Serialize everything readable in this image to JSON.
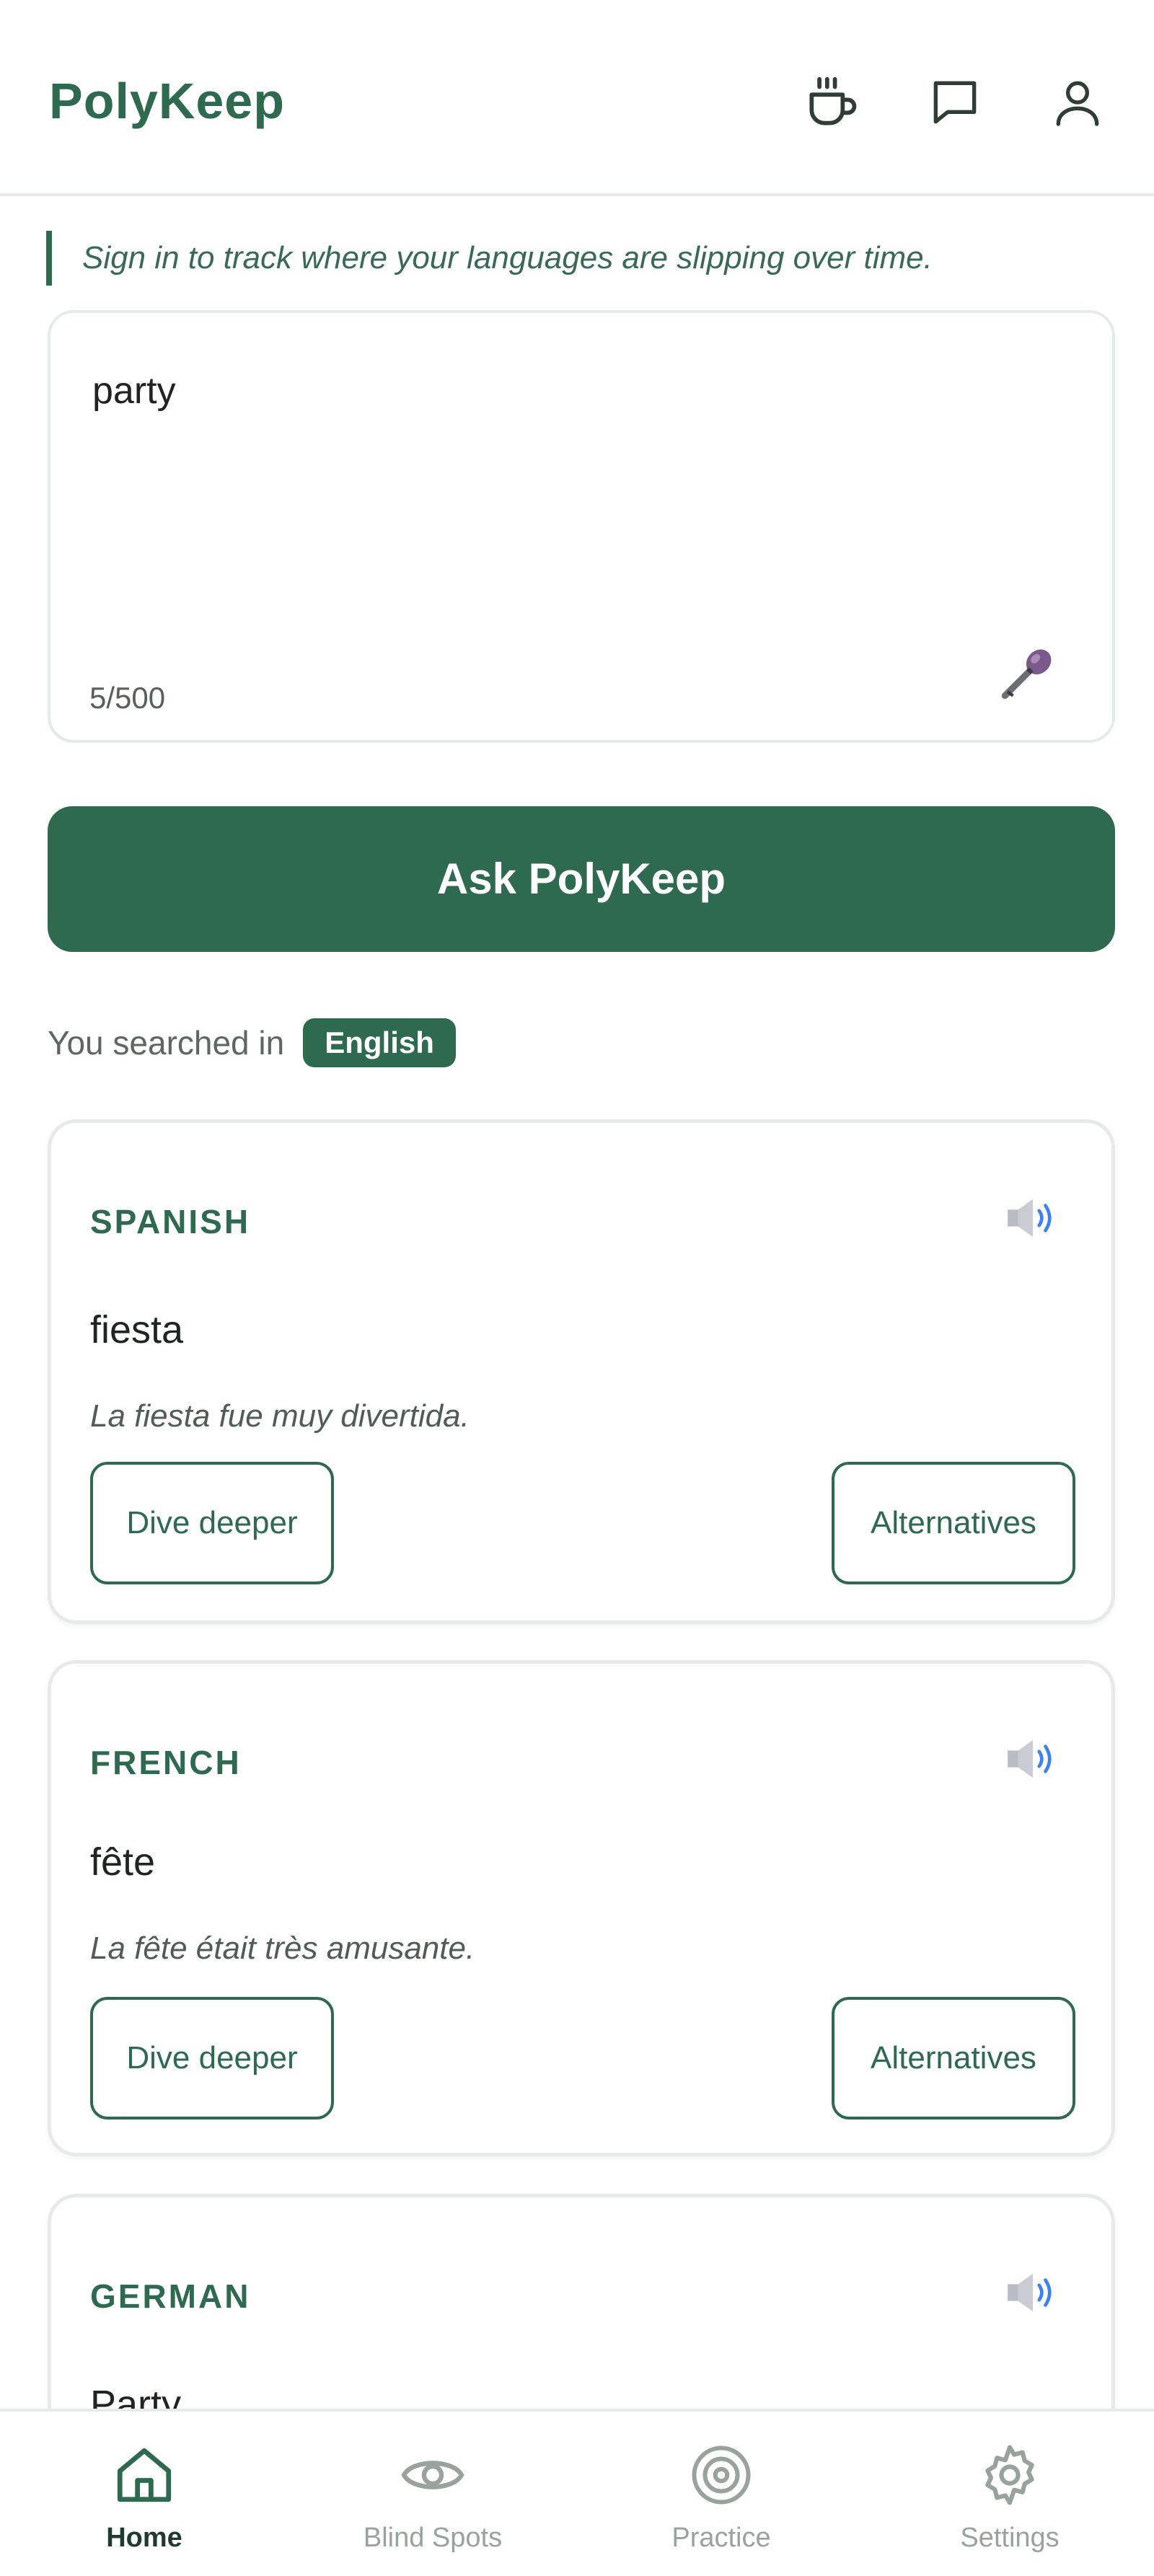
{
  "header": {
    "brand": "PolyKeep",
    "icons": [
      "coffee-icon",
      "chat-icon",
      "user-icon"
    ]
  },
  "hint": "Sign in to track where your languages are slipping over time.",
  "input": {
    "value": "party",
    "char_count": "5/500"
  },
  "ask_button": "Ask PolyKeep",
  "searched": {
    "label": "You searched in",
    "language": "English"
  },
  "results": [
    {
      "language": "SPANISH",
      "word": "fiesta",
      "example": "La fiesta fue muy divertida.",
      "dive": "Dive deeper",
      "alternatives": "Alternatives"
    },
    {
      "language": "FRENCH",
      "word": "fête",
      "example": "La fête était très amusante.",
      "dive": "Dive deeper",
      "alternatives": "Alternatives"
    },
    {
      "language": "GERMAN",
      "word": "Party",
      "example": "",
      "dive": "",
      "alternatives": ""
    }
  ],
  "nav": [
    {
      "label": "Home",
      "icon": "home-icon",
      "active": true
    },
    {
      "label": "Blind Spots",
      "icon": "eye-icon",
      "active": false
    },
    {
      "label": "Practice",
      "icon": "target-icon",
      "active": false
    },
    {
      "label": "Settings",
      "icon": "gear-icon",
      "active": false
    }
  ],
  "colors": {
    "accent": "#2d6a4f",
    "border": "#e8eaea",
    "muted": "#9aa29e"
  }
}
